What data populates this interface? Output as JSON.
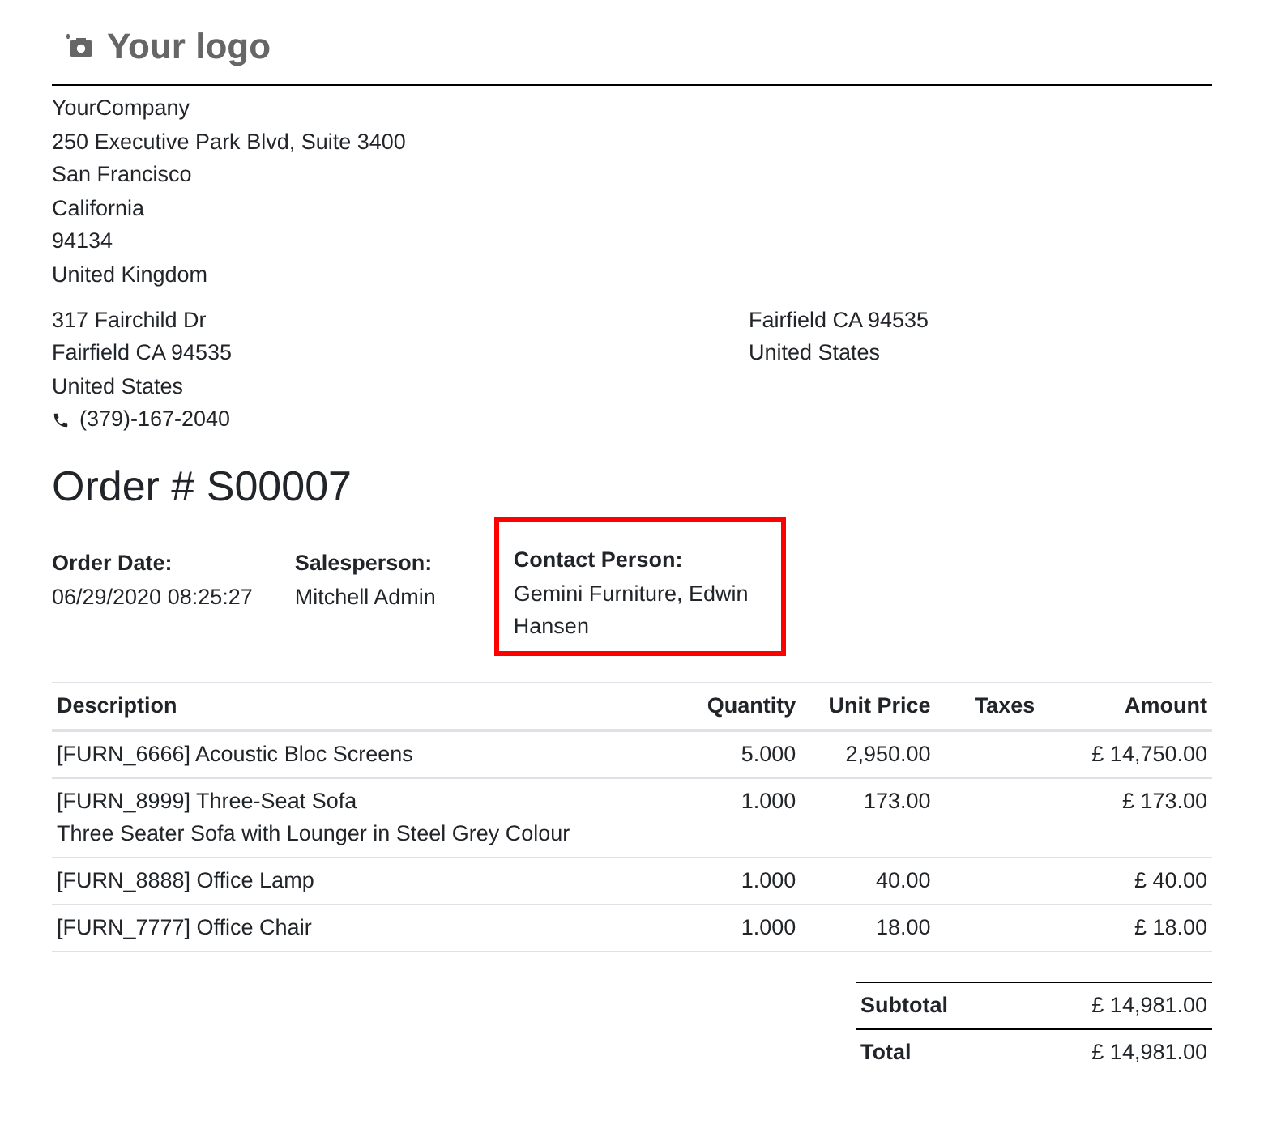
{
  "logo": {
    "text": "Your logo"
  },
  "company": {
    "lines": [
      "YourCompany",
      "250 Executive Park Blvd, Suite 3400",
      "San Francisco",
      "California",
      "94134",
      "United Kingdom"
    ]
  },
  "customer_address": {
    "lines": [
      "317 Fairchild Dr",
      "Fairfield CA 94535",
      "United States"
    ],
    "phone": "(379)-167-2040"
  },
  "shipping_address": {
    "lines": [
      "Fairfield CA 94535",
      "United States"
    ]
  },
  "title": "Order # S00007",
  "info": [
    {
      "label": "Order Date:",
      "value": "06/29/2020 08:25:27",
      "highlighted": false
    },
    {
      "label": "Salesperson:",
      "value": "Mitchell Admin",
      "highlighted": false
    },
    {
      "label": "Contact Person:",
      "value": "Gemini Furniture, Edwin Hansen",
      "highlighted": true
    }
  ],
  "table": {
    "columns": [
      "Description",
      "Quantity",
      "Unit Price",
      "Taxes",
      "Amount"
    ],
    "rows": [
      {
        "description": "[FURN_6666] Acoustic Bloc Screens",
        "note": "",
        "quantity": "5.000",
        "unit_price": "2,950.00",
        "amount": "£ 14,750.00"
      },
      {
        "description": "[FURN_8999] Three-Seat Sofa",
        "note": "Three Seater Sofa with Lounger in Steel Grey Colour",
        "quantity": "1.000",
        "unit_price": "173.00",
        "amount": "£ 173.00"
      },
      {
        "description": "[FURN_8888] Office Lamp",
        "note": "",
        "quantity": "1.000",
        "unit_price": "40.00",
        "amount": "£ 40.00"
      },
      {
        "description": "[FURN_7777] Office Chair",
        "note": "",
        "quantity": "1.000",
        "unit_price": "18.00",
        "amount": "£ 18.00"
      }
    ]
  },
  "totals": [
    {
      "label": "Subtotal",
      "value": "£ 14,981.00"
    },
    {
      "label": "Total",
      "value": "£ 14,981.00"
    }
  ]
}
